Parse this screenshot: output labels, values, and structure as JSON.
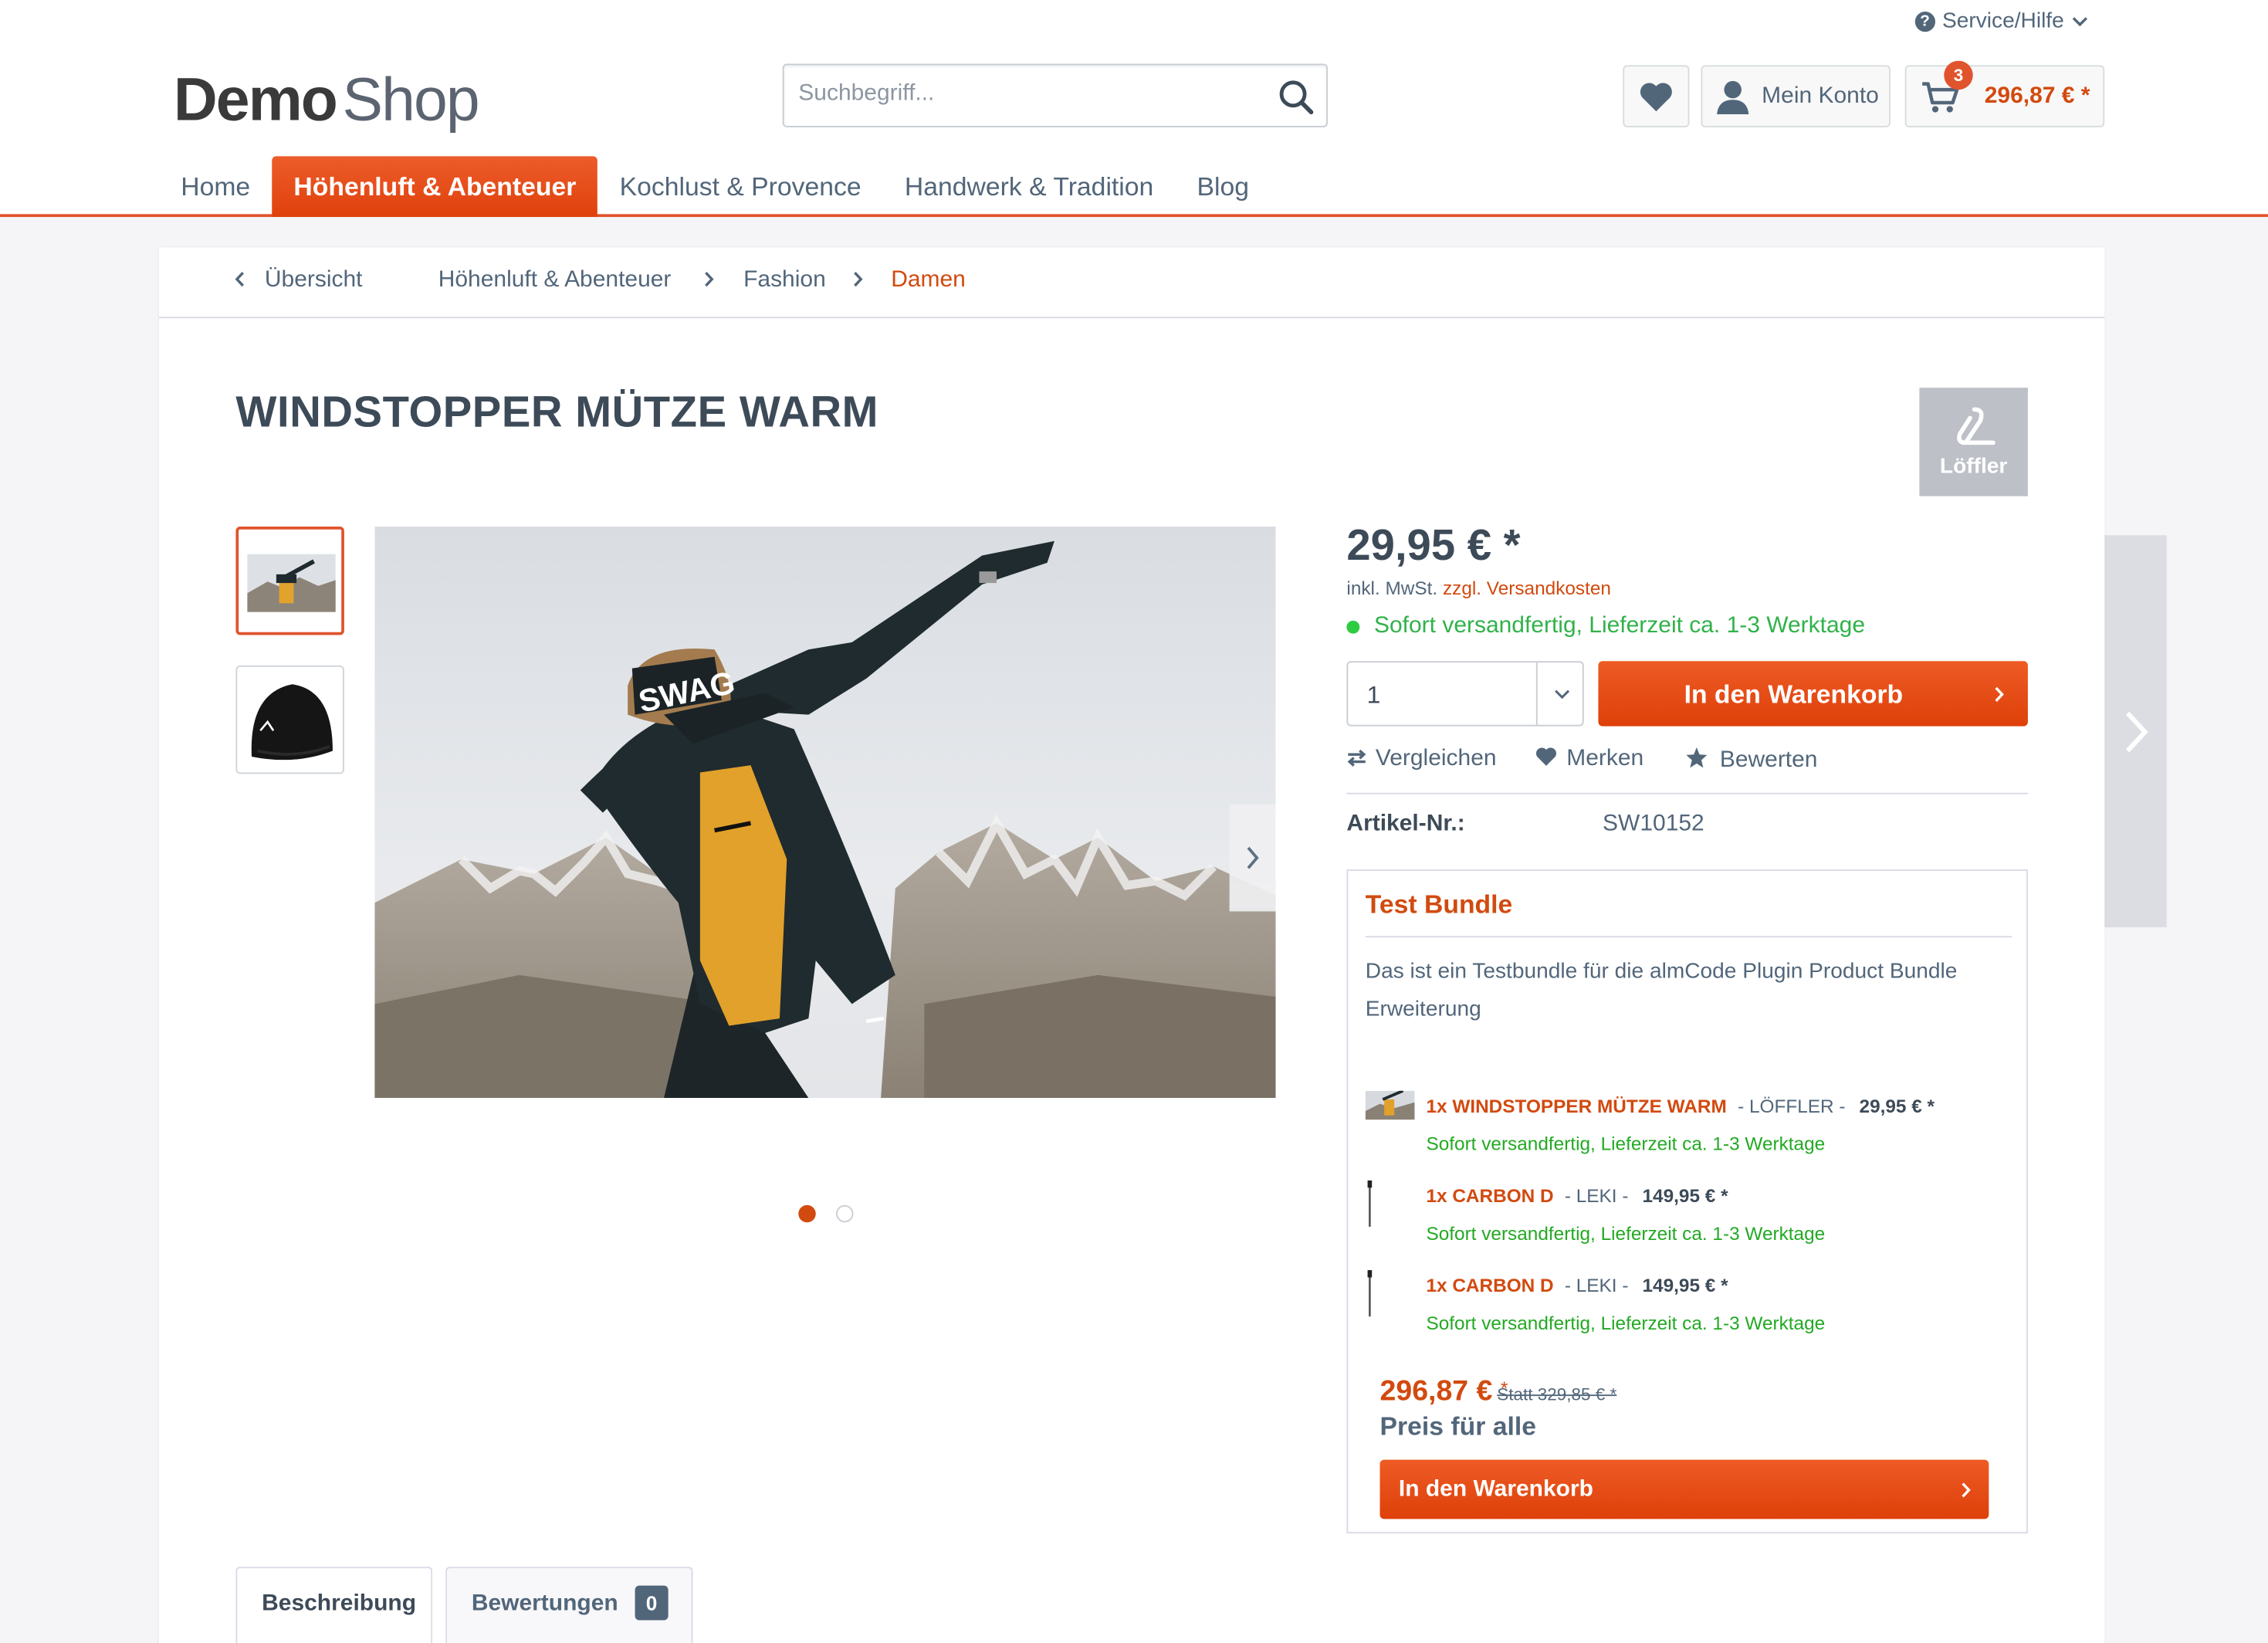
{
  "header": {
    "service_label": "Service/Hilfe",
    "logo_part1": "Demo",
    "logo_part2": "Shop",
    "search_placeholder": "Suchbegriff...",
    "account_label": "Mein Konto",
    "cart_count": "3",
    "cart_total": "296,87 € *"
  },
  "nav": {
    "items": [
      "Home",
      "Höhenluft & Abenteuer",
      "Kochlust & Provence",
      "Handwerk & Tradition",
      "Blog"
    ],
    "active": "Höhenluft & Abenteuer"
  },
  "breadcrumb": {
    "back_label": "Übersicht",
    "items": [
      "Höhenluft & Abenteuer",
      "Fashion",
      "Damen"
    ]
  },
  "product": {
    "title": "WINDSTOPPER MÜTZE WARM",
    "brand_name": "Löffler",
    "price": "29,95 € *",
    "tax_note": "inkl. MwSt.",
    "shipping_link": "zzgl. Versandkosten",
    "delivery": "Sofort versandfertig, Lieferzeit ca. 1-3 Werktage",
    "quantity": "1",
    "cart_button": "In den Warenkorb",
    "actions": {
      "compare": "Vergleichen",
      "remember": "Merken",
      "rate": "Bewerten"
    },
    "article_label": "Artikel-Nr.:",
    "article_number": "SW10152",
    "image_text": "SWAG"
  },
  "bundle": {
    "title": "Test Bundle",
    "description": "Das ist ein Testbundle für die almCode Plugin Product Bundle Erweiterung",
    "items": [
      {
        "name": "1x WINDSTOPPER MÜTZE WARM",
        "brand": "- LÖFFLER -",
        "price": "29,95 € *",
        "status": "Sofort versandfertig, Lieferzeit ca. 1-3 Werktage"
      },
      {
        "name": "1x CARBON D",
        "brand": "- LEKI -",
        "price": "149,95 € *",
        "status": "Sofort versandfertig, Lieferzeit ca. 1-3 Werktage"
      },
      {
        "name": "1x CARBON D",
        "brand": "- LEKI -",
        "price": "149,95 € *",
        "status": "Sofort versandfertig, Lieferzeit ca. 1-3 Werktage"
      }
    ],
    "total": "296,87 €",
    "total_star": "*",
    "instead": "Statt 329,85 € *",
    "price_label": "Preis für alle",
    "cart_button": "In den Warenkorb"
  },
  "tabs": {
    "description": "Beschreibung",
    "reviews": "Bewertungen",
    "reviews_count": "0"
  },
  "colors": {
    "accent": "#e0542d",
    "cart_red": "#d24a0f",
    "success_green": "#30b24a",
    "text": "#52667a"
  },
  "icons": [
    "question-circle-icon",
    "chevron-down-icon",
    "search-icon",
    "heart-icon",
    "user-icon",
    "cart-icon",
    "chevron-left-icon",
    "chevron-right-icon",
    "compare-icon",
    "star-icon"
  ]
}
